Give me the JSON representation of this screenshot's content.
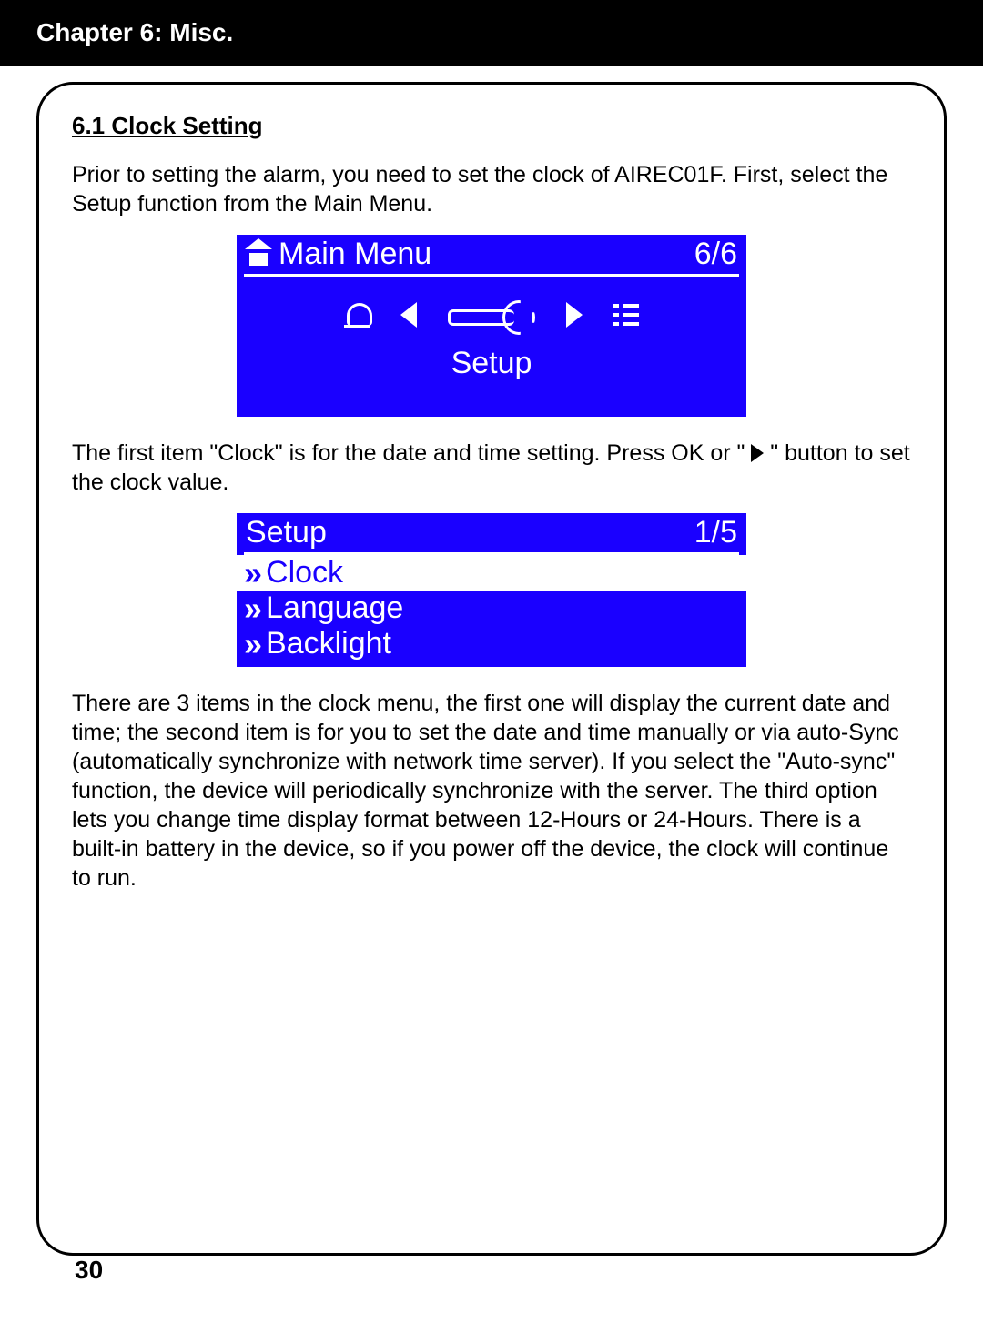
{
  "header": {
    "chapter_title": "Chapter 6: Misc."
  },
  "section": {
    "heading": "6.1 Clock Setting"
  },
  "para1": "Prior to setting the alarm, you need to set the clock of AIREC01F. First, select the Setup function from the Main Menu.",
  "screen1": {
    "title": "Main Menu",
    "position": "6/6",
    "selected_label": "Setup"
  },
  "para2_pre": "The first item \"Clock\" is for the date and time setting. Press OK or  \" ",
  "para2_post": " \" button to set the clock value.",
  "screen2": {
    "title": "Setup",
    "position": "1/5",
    "items": {
      "0": {
        "label": "Clock"
      },
      "1": {
        "label": "Language"
      },
      "2": {
        "label": "Backlight"
      }
    }
  },
  "para3": "There are 3 items in the clock menu, the first one will display the current date and time; the second item is for you to set the date and time manually or via auto-Sync (automatically synchronize with network time server). If you select the \"Auto-sync\" function, the device will periodically synchronize with the server. The third option lets you change time display format between 12-Hours or 24-Hours. There is a built-in battery in the device, so if you power off the device, the clock will continue to run.",
  "page_number": "30"
}
